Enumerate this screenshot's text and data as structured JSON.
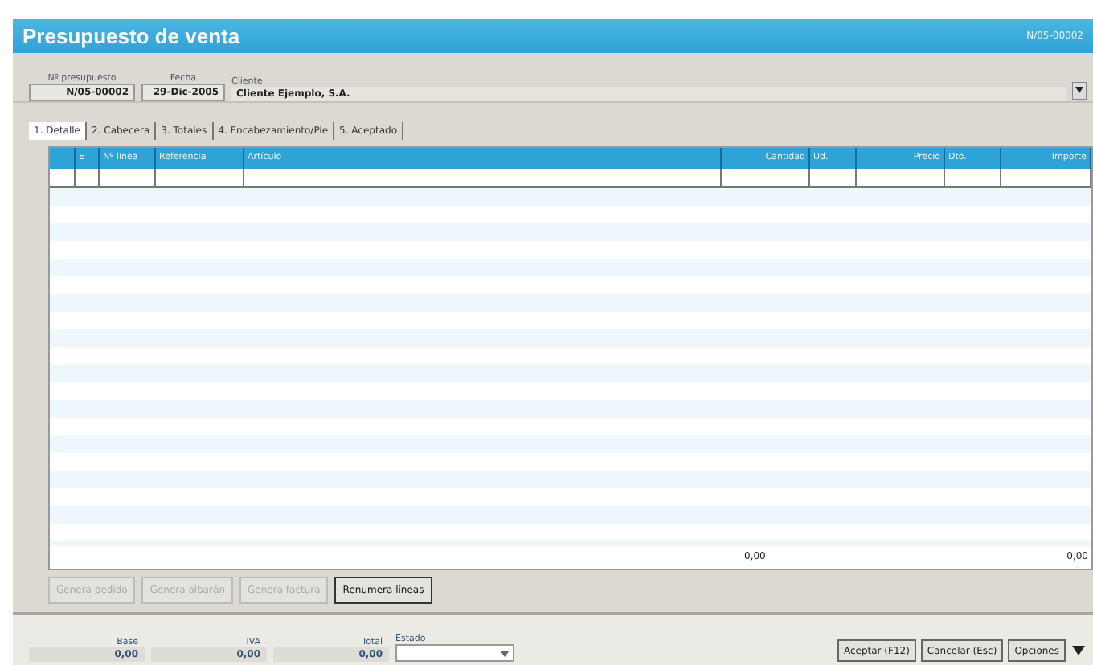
{
  "window": {
    "title": "Presupuesto de venta",
    "document_number": "N/05-00002"
  },
  "header": {
    "fields": [
      {
        "label": "Nº presupuesto",
        "value": "N/05-00002"
      },
      {
        "label": "Fecha",
        "value": "29-Dic-2005"
      },
      {
        "label": "Cliente",
        "value": "Cliente Ejemplo, S.A."
      }
    ]
  },
  "tabs": [
    {
      "label": "1. Detalle",
      "selected": true
    },
    {
      "label": "2. Cabecera",
      "selected": false
    },
    {
      "label": "3. Totales",
      "selected": false
    },
    {
      "label": "4. Encabezamiento/Pie",
      "selected": false
    },
    {
      "label": "5. Aceptado",
      "selected": false
    }
  ],
  "table": {
    "columns": [
      "E",
      "Nº línea",
      "Referencia",
      "Artículo",
      "Cantidad",
      "Ud.",
      "Precio",
      "Dto.",
      "Importe"
    ],
    "totals": {
      "cantidad": "0,00",
      "importe": "0,00"
    }
  },
  "actions": [
    {
      "label": "Genera pedido",
      "disabled": true
    },
    {
      "label": "Genera albarán",
      "disabled": true
    },
    {
      "label": "Genera factura",
      "disabled": true
    },
    {
      "label": "Renumera líneas",
      "disabled": false
    }
  ],
  "summary": [
    {
      "label": "Base",
      "value": "0,00"
    },
    {
      "label": "IVA",
      "value": "0,00"
    },
    {
      "label": "Total",
      "value": "0,00"
    }
  ],
  "status": {
    "label": "Estado"
  },
  "buttons": [
    "Aceptar (F12)",
    "Cancelar (Esc)",
    "Opciones"
  ]
}
